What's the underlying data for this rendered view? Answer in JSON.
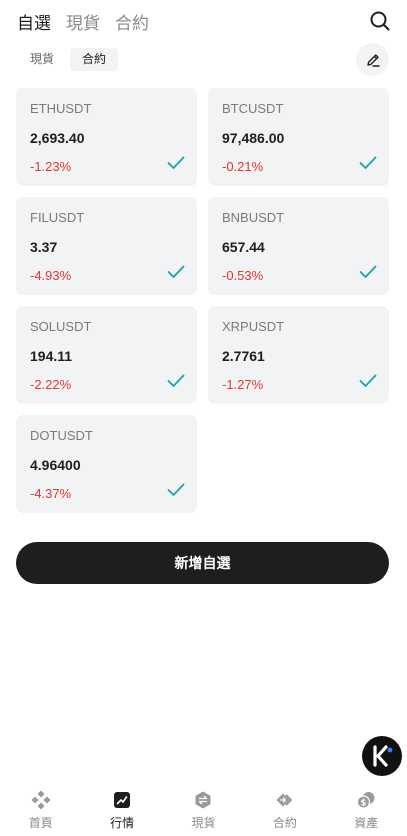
{
  "top_tabs": [
    {
      "label": "自選",
      "active": true
    },
    {
      "label": "現貨",
      "active": false
    },
    {
      "label": "合約",
      "active": false
    }
  ],
  "sub_tabs": [
    {
      "label": "現貨",
      "active": false
    },
    {
      "label": "合約",
      "active": true
    }
  ],
  "cards": [
    {
      "symbol": "ETHUSDT",
      "price": "2,693.40",
      "change": "-1.23%"
    },
    {
      "symbol": "BTCUSDT",
      "price": "97,486.00",
      "change": "-0.21%"
    },
    {
      "symbol": "FILUSDT",
      "price": "3.37",
      "change": "-4.93%"
    },
    {
      "symbol": "BNBUSDT",
      "price": "657.44",
      "change": "-0.53%"
    },
    {
      "symbol": "SOLUSDT",
      "price": "194.11",
      "change": "-2.22%"
    },
    {
      "symbol": "XRPUSDT",
      "price": "2.7761",
      "change": "-1.27%"
    },
    {
      "symbol": "DOTUSDT",
      "price": "4.96400",
      "change": "-4.37%"
    }
  ],
  "add_button_label": "新增自選",
  "bottom_nav": [
    {
      "label": "首頁",
      "icon": "home-icon",
      "active": false
    },
    {
      "label": "行情",
      "icon": "market-icon",
      "active": true
    },
    {
      "label": "現貨",
      "icon": "spot-icon",
      "active": false
    },
    {
      "label": "合約",
      "icon": "futures-icon",
      "active": false
    },
    {
      "label": "資產",
      "icon": "assets-icon",
      "active": false
    }
  ],
  "colors": {
    "negative": "#e5352f",
    "check": "#1aa6a6",
    "card_bg": "#f2f3f5",
    "primary_button": "#1e1e1e"
  }
}
